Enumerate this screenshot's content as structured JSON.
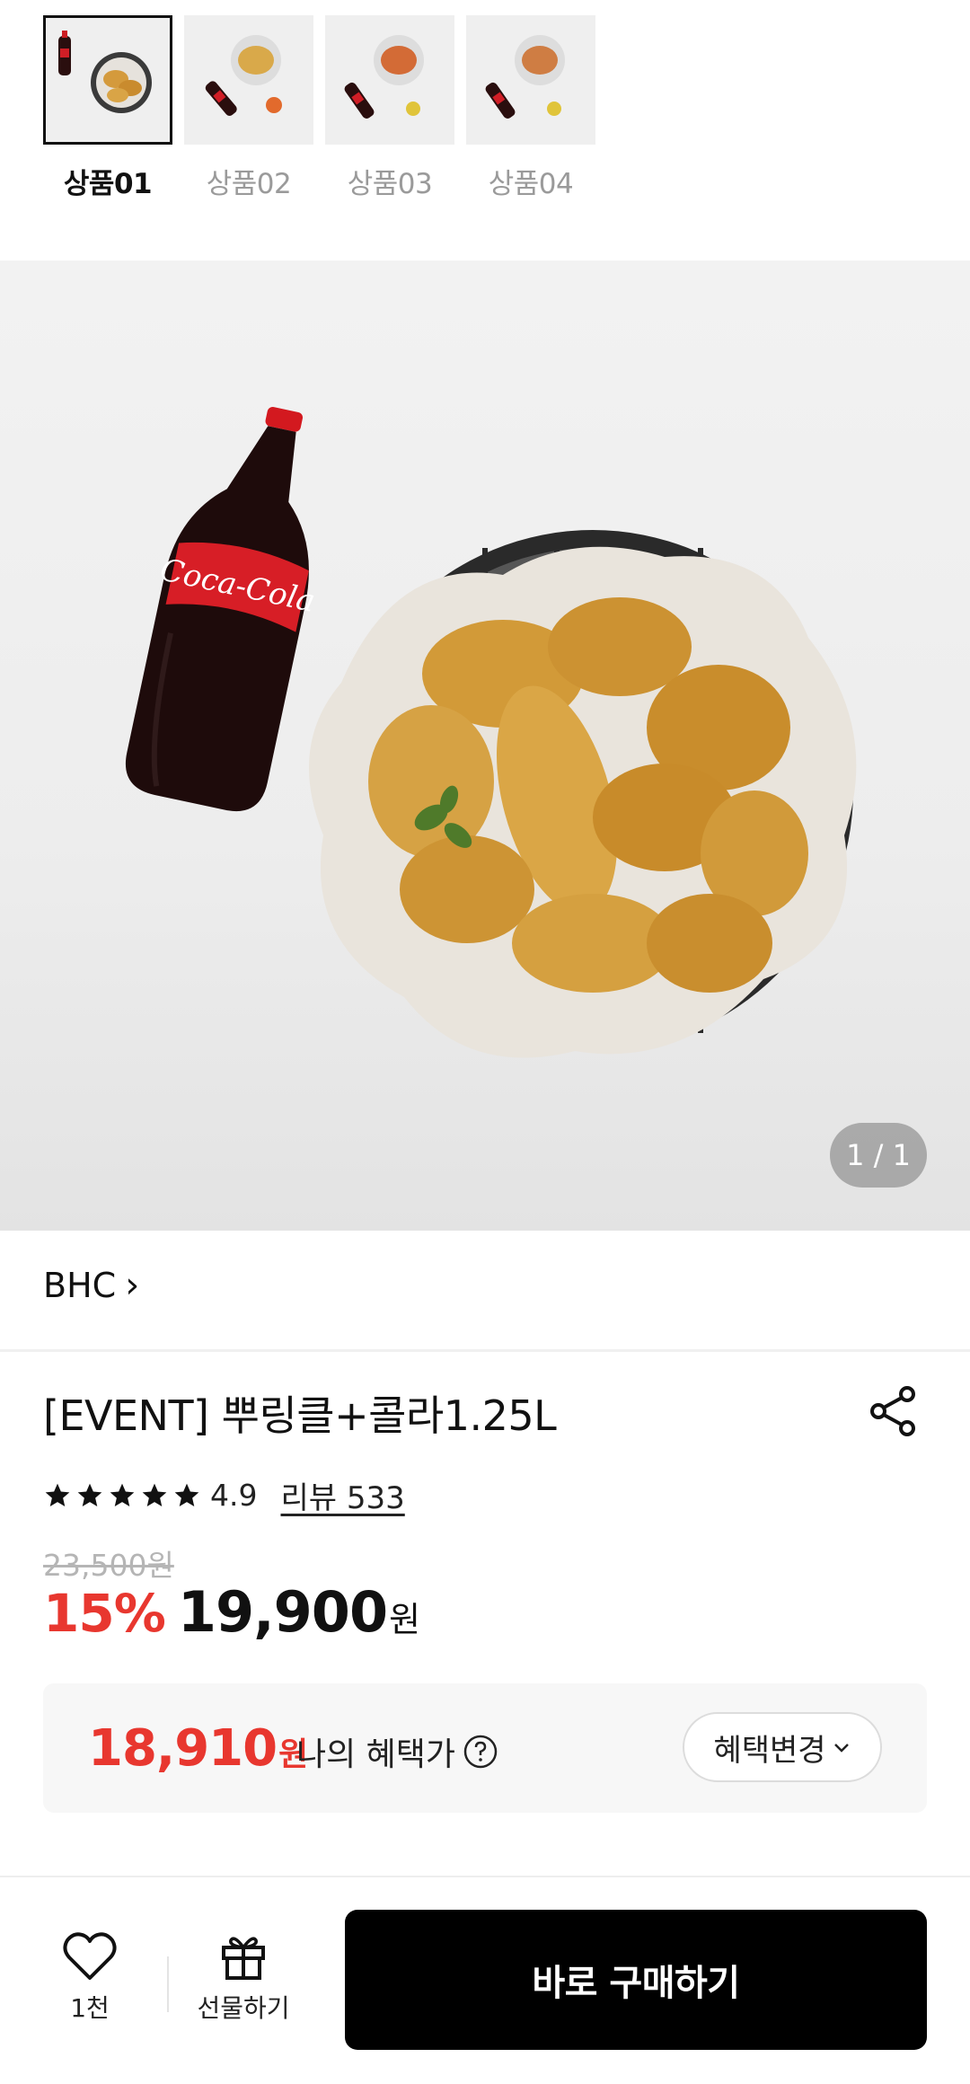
{
  "thumbnails": [
    {
      "label": "상품01",
      "active": true
    },
    {
      "label": "상품02",
      "active": false
    },
    {
      "label": "상품03",
      "active": false
    },
    {
      "label": "상품04",
      "active": false
    }
  ],
  "hero": {
    "bottle_label": "Coca-Cola",
    "counter": "1 / 1"
  },
  "brand": {
    "name": "BHC",
    "chevron": "›"
  },
  "product": {
    "title": "[EVENT] 뿌링클+콜라1.25L",
    "rating": "4.9",
    "stars": 5,
    "review_link": "리뷰 533",
    "original_price": "23,500원",
    "discount": "15%",
    "price": "19,900",
    "price_unit": "원"
  },
  "benefit": {
    "price": "18,910",
    "unit": "원",
    "label": "나의 혜택가",
    "button": "혜택변경"
  },
  "bottom_bar": {
    "like_count": "1천",
    "gift_label": "선물하기",
    "buy_label": "바로 구매하기"
  },
  "icons": {
    "share": "share-icon",
    "heart": "heart-icon",
    "gift": "gift-icon",
    "question": "question-circle-icon",
    "chevron_down": "chevron-down-icon",
    "star": "star-icon"
  },
  "colors": {
    "accent_red": "#e8372f",
    "buy_button": "#000000"
  }
}
